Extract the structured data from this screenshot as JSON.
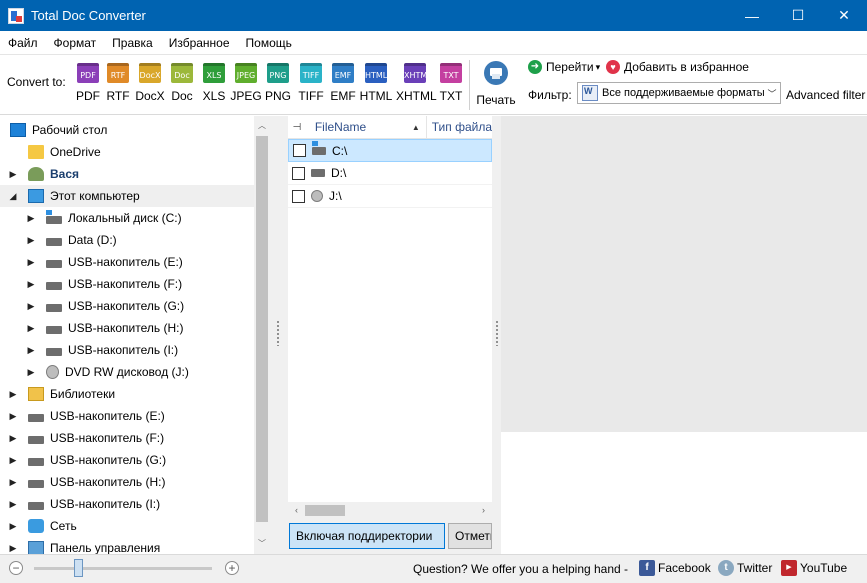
{
  "window": {
    "title": "Total Doc Converter",
    "minimize": "—",
    "maximize": "☐",
    "close": "✕"
  },
  "menu": [
    "Файл",
    "Формат",
    "Правка",
    "Избранное",
    "Помощь"
  ],
  "toolbar": {
    "convert_label": "Convert to:",
    "formats": [
      {
        "label": "PDF",
        "icon_text": "PDF",
        "color": "#8b3fb8"
      },
      {
        "label": "RTF",
        "icon_text": "RTF",
        "color": "#e08a28"
      },
      {
        "label": "DocX",
        "icon_text": "DocX",
        "color": "#d9a72a"
      },
      {
        "label": "Doc",
        "icon_text": "Doc",
        "color": "#9cb83a"
      },
      {
        "label": "XLS",
        "icon_text": "XLS",
        "color": "#2f9e3a"
      },
      {
        "label": "JPEG",
        "icon_text": "JPEG",
        "color": "#5fae2d"
      },
      {
        "label": "PNG",
        "icon_text": "PNG",
        "color": "#1e9e8a"
      },
      {
        "label": "TIFF",
        "icon_text": "TIFF",
        "color": "#2ab3c8"
      },
      {
        "label": "EMF",
        "icon_text": "EMF",
        "color": "#2f7ec6"
      },
      {
        "label": "HTML",
        "icon_text": "HTML",
        "color": "#2a5fc0"
      },
      {
        "label": "XHTML",
        "icon_text": "XHTML",
        "color": "#6a3fb8"
      },
      {
        "label": "TXT",
        "icon_text": "TXT",
        "color": "#c43fa0"
      }
    ],
    "print_label": "Печать",
    "goto_label": "Перейти",
    "goto_arrow": "▾",
    "favorite_label": "Добавить в избранное",
    "filter_label": "Фильтр:",
    "filter_value": "Все поддерживаемые форматы",
    "advanced_filter": "Advanced filter"
  },
  "tree": {
    "items": [
      {
        "label": "Рабочий стол",
        "icon": "desktop-icon",
        "expander": "",
        "bold": false
      },
      {
        "label": "OneDrive",
        "icon": "folder-icon",
        "expander": "",
        "bold": false
      },
      {
        "label": "Вася",
        "icon": "user-icon",
        "expander": "▶",
        "bold": true
      },
      {
        "label": "Этот компьютер",
        "icon": "computer-icon",
        "expander": "◢",
        "bold": false
      },
      {
        "label": "Локальный диск (C:)",
        "icon": "system-drive-icon",
        "expander": "▶",
        "bold": false
      },
      {
        "label": "Data (D:)",
        "icon": "drive-icon",
        "expander": "▶",
        "bold": false
      },
      {
        "label": "USB-накопитель (E:)",
        "icon": "drive-icon",
        "expander": "▶",
        "bold": false
      },
      {
        "label": "USB-накопитель (F:)",
        "icon": "drive-icon",
        "expander": "▶",
        "bold": false
      },
      {
        "label": "USB-накопитель (G:)",
        "icon": "drive-icon",
        "expander": "▶",
        "bold": false
      },
      {
        "label": "USB-накопитель (H:)",
        "icon": "drive-icon",
        "expander": "▶",
        "bold": false
      },
      {
        "label": "USB-накопитель (I:)",
        "icon": "drive-icon",
        "expander": "▶",
        "bold": false
      },
      {
        "label": "DVD RW дисковод (J:)",
        "icon": "dvd-drive-icon",
        "expander": "▶",
        "bold": false
      },
      {
        "label": "Библиотеки",
        "icon": "libraries-icon",
        "expander": "▶",
        "bold": false
      },
      {
        "label": "USB-накопитель (E:)",
        "icon": "drive-icon",
        "expander": "▶",
        "bold": false
      },
      {
        "label": "USB-накопитель (F:)",
        "icon": "drive-icon",
        "expander": "▶",
        "bold": false
      },
      {
        "label": "USB-накопитель (G:)",
        "icon": "drive-icon",
        "expander": "▶",
        "bold": false
      },
      {
        "label": "USB-накопитель (H:)",
        "icon": "drive-icon",
        "expander": "▶",
        "bold": false
      },
      {
        "label": "USB-накопитель (I:)",
        "icon": "drive-icon",
        "expander": "▶",
        "bold": false
      },
      {
        "label": "Сеть",
        "icon": "network-icon",
        "expander": "▶",
        "bold": false
      },
      {
        "label": "Панель управления",
        "icon": "control-panel-icon",
        "expander": "▶",
        "bold": false
      }
    ]
  },
  "filelist": {
    "columns": [
      "FileName",
      "Тип файла"
    ],
    "rows": [
      {
        "name": "C:\\",
        "icon": "system-drive-icon"
      },
      {
        "name": "D:\\",
        "icon": "drive-icon"
      },
      {
        "name": "J:\\",
        "icon": "dvd-drive-icon"
      }
    ],
    "include_subdirs": "Включая поддиректории",
    "mark_tab": "Отметить"
  },
  "statusbar": {
    "zoom_minus": "−",
    "zoom_plus": "+",
    "help_text": "Question? We offer you a helping hand -",
    "facebook": "Facebook",
    "twitter": "Twitter",
    "youtube": "YouTube"
  },
  "colors": {
    "titlebar": "#0063b1",
    "selection": "#cce8ff",
    "preview_bg": "#e9e9e9"
  }
}
